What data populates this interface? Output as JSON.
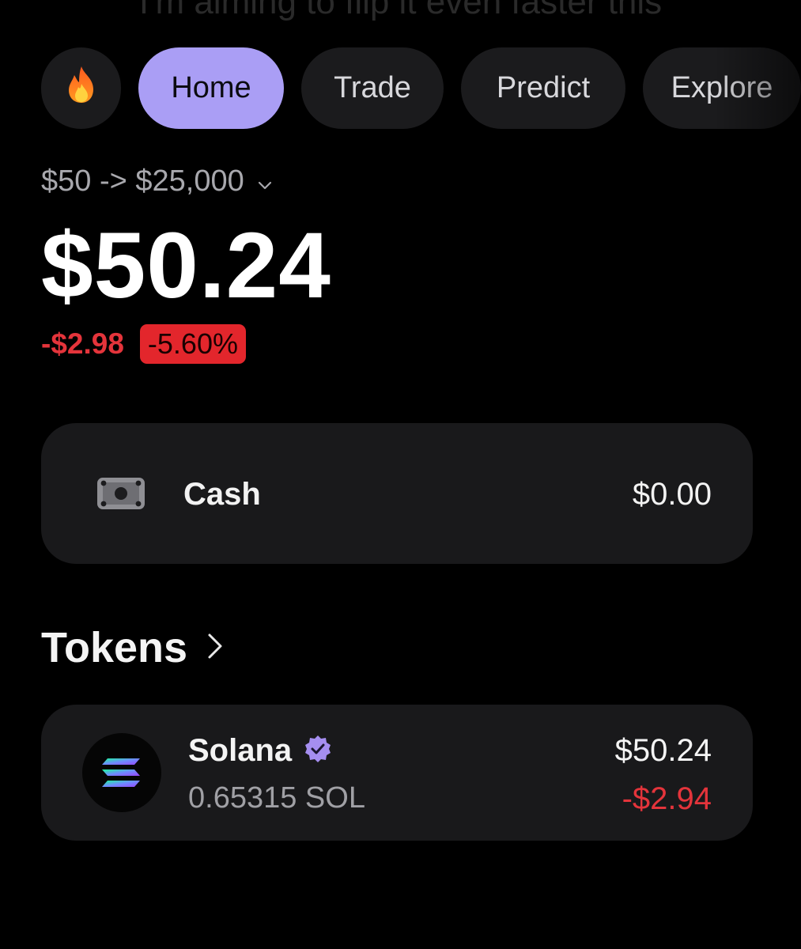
{
  "header": {
    "caption": "I'm aiming to flip it even faster this",
    "nav_tabs": [
      {
        "label": "🔥",
        "icon": "fire-icon",
        "active": false
      },
      {
        "label": "Home",
        "active": true
      },
      {
        "label": "Trade",
        "active": false
      },
      {
        "label": "Predict",
        "active": false
      },
      {
        "label": "Explore",
        "active": false
      }
    ]
  },
  "portfolio": {
    "goal": "$50 -> $25,000",
    "balance": "$50.24",
    "change_amount": "-$2.98",
    "change_percent": "-5.60%"
  },
  "cash": {
    "icon": "cash-icon",
    "label": "Cash",
    "value": "$0.00"
  },
  "tokens": {
    "title": "Tokens",
    "items": [
      {
        "name": "Solana",
        "verified": true,
        "amount": "0.65315 SOL",
        "value": "$50.24",
        "change": "-$2.94",
        "icon": "solana-logo-icon"
      }
    ]
  },
  "colors": {
    "background": "#000000",
    "active_tab": "#aa9ef5",
    "negative": "#e4343b",
    "card": "#19191b",
    "verified_badge": "#a58ef0"
  }
}
